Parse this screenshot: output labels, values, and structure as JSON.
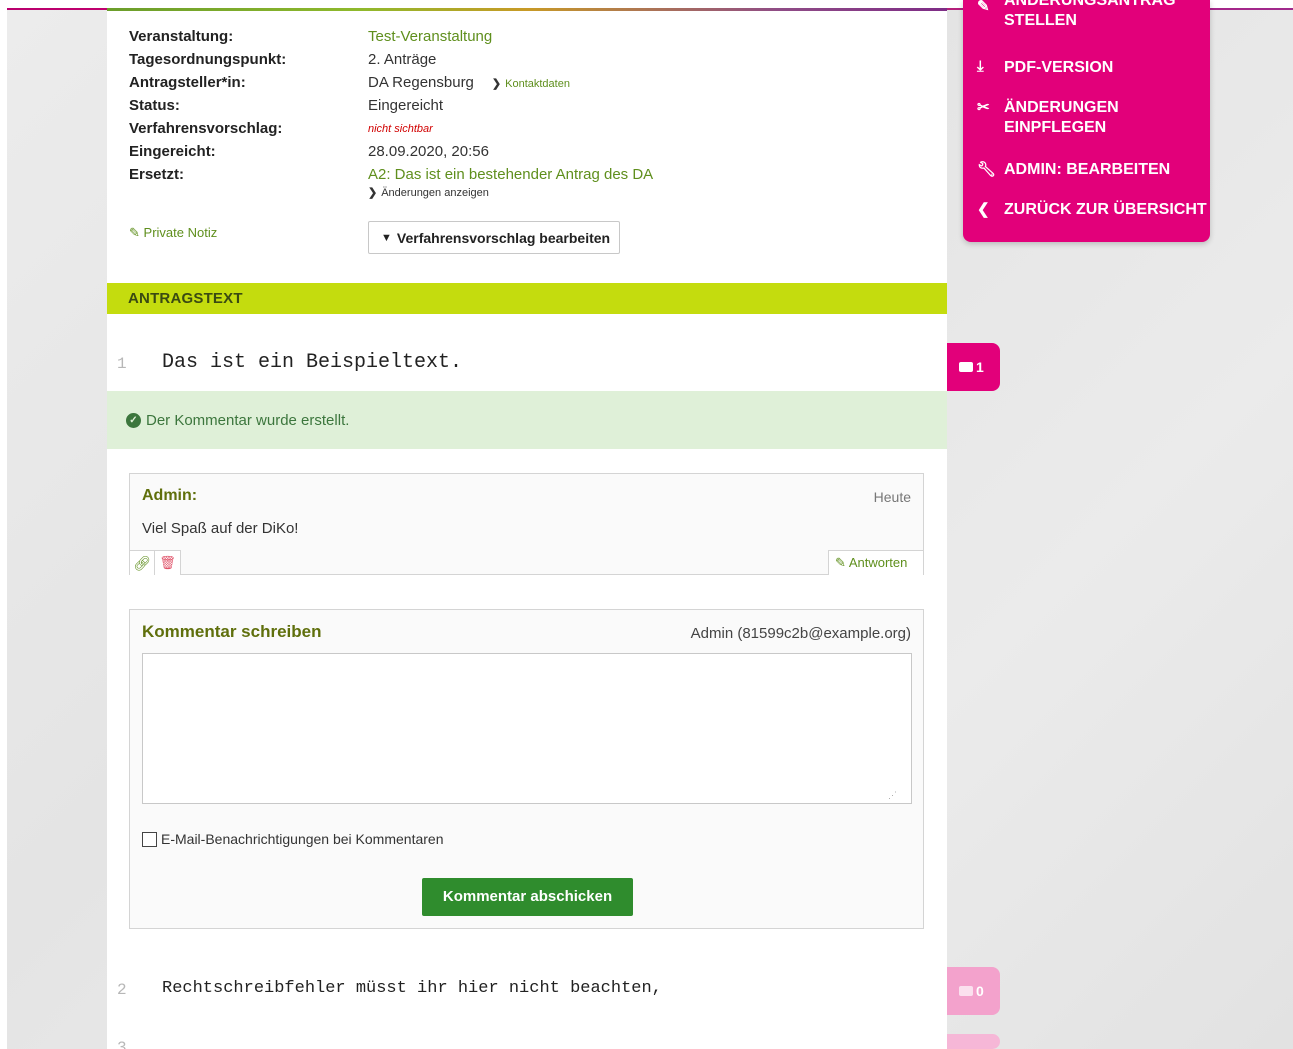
{
  "meta": {
    "rows": [
      {
        "label": "Veranstaltung:",
        "value": "Test-Veranstaltung"
      },
      {
        "label": "Tagesordnungspunkt:",
        "value": "2. Anträge"
      },
      {
        "label": "Antragsteller*in:",
        "value": "DA Regensburg",
        "extra_link": "Kontaktdaten"
      },
      {
        "label": "Status:",
        "value": "Eingereicht"
      },
      {
        "label": "Verfahrensvorschlag:",
        "value": "nicht sichtbar"
      },
      {
        "label": "Eingereicht:",
        "value": "28.09.2020, 20:56"
      },
      {
        "label": "Ersetzt:",
        "value": "A2: Das ist ein bestehender Antrag des DA",
        "sub_link": "Änderungen anzeigen"
      }
    ],
    "private_note": "Private Notiz",
    "procedure_button": "Verfahrensvorschlag bearbeiten"
  },
  "section": {
    "title": "ANTRAGSTEXT"
  },
  "lines": [
    {
      "num": "1",
      "text": "Das ist ein Beispieltext."
    },
    {
      "num": "2",
      "text": "Rechtschreibfehler müsst ihr hier nicht beachten,"
    }
  ],
  "alert": {
    "text": "Der Kommentar wurde erstellt."
  },
  "comment": {
    "author": "Admin:",
    "date": "Heute",
    "text": "Viel Spaß auf der DiKo!",
    "reply_label": "Antworten"
  },
  "write": {
    "title": "Kommentar schreiben",
    "user": "Admin (81599c2b@example.org)",
    "textarea_value": "",
    "checkbox_label": "E-Mail-Benachrichtigungen bei Kommentaren",
    "submit_label": "Kommentar abschicken"
  },
  "sidebar": {
    "items": [
      {
        "icon": "pencil-icon",
        "label": "ÄNDERUNGSANTRAG STELLEN"
      },
      {
        "icon": "download-icon",
        "label": "PDF-VERSION"
      },
      {
        "icon": "scissors-icon",
        "label": "ÄNDERUNGEN EINPFLEGEN"
      },
      {
        "icon": "wrench-icon",
        "label": "ADMIN: BEARBEITEN"
      },
      {
        "icon": "chevron-left-icon",
        "label": "ZURÜCK ZUR ÜBERSICHT"
      }
    ]
  },
  "bubbles": [
    {
      "count": "1"
    },
    {
      "count": "0"
    }
  ],
  "colors": {
    "accent_pink": "#e2007a",
    "section_green": "#c4dc0e",
    "link_green": "#5f8f1d",
    "success_bg": "#dff0d8",
    "submit_green": "#2f8c2d"
  }
}
